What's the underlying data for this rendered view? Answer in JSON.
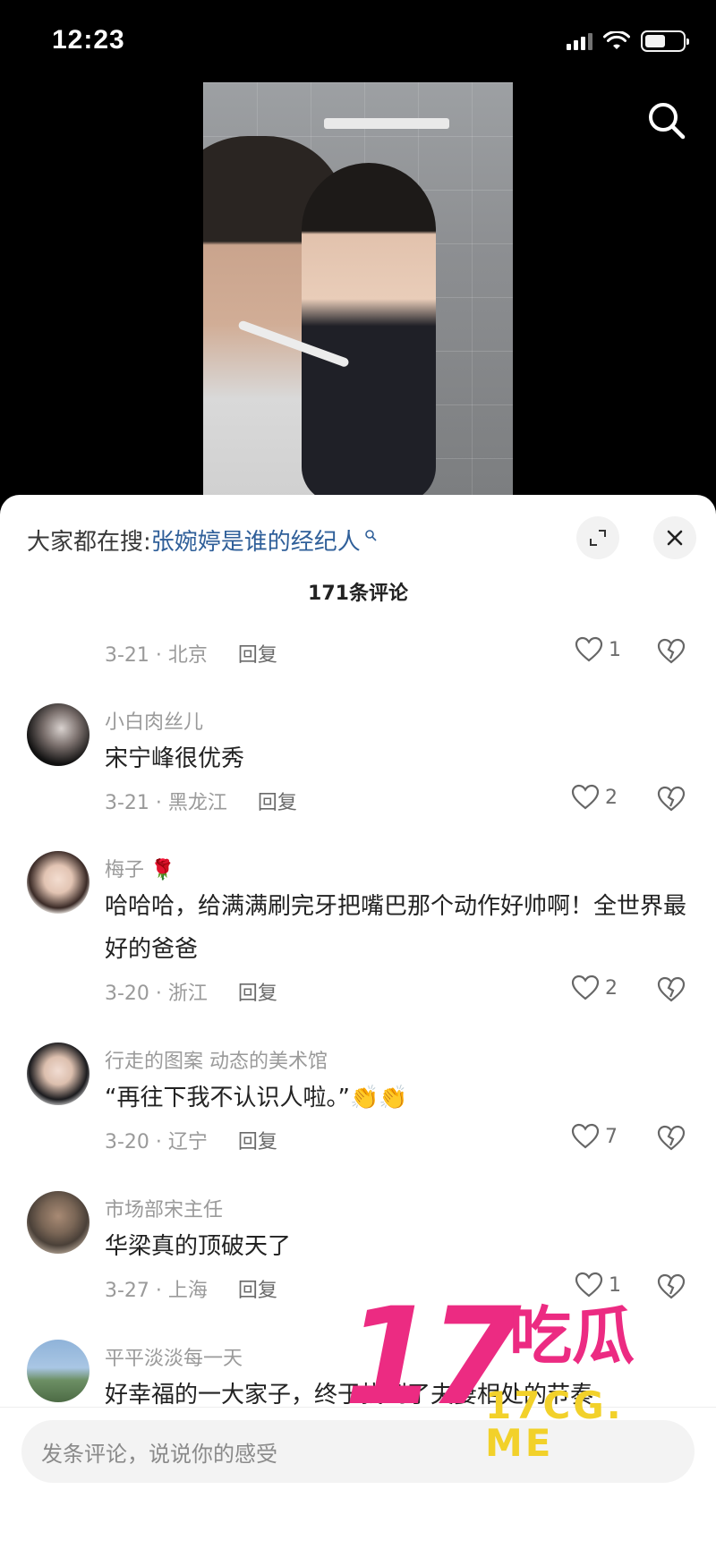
{
  "status_bar": {
    "time": "12:23"
  },
  "sheet": {
    "trending_prefix": "大家都在搜:",
    "trending_link": "张婉婷是谁的经纪人",
    "comment_count": "171条评论"
  },
  "comments": [
    {
      "date_location": "3-21 · 北京",
      "reply": "回复",
      "likes": "1"
    },
    {
      "username": "小白肉丝儿",
      "text": "宋宁峰很优秀",
      "date_location": "3-21 · 黑龙江",
      "reply": "回复",
      "likes": "2"
    },
    {
      "username": "梅子",
      "badge": "🌹",
      "text": "哈哈哈，给满满刷完牙把嘴巴那个动作好帅啊！全世界最好的爸爸",
      "date_location": "3-20 · 浙江",
      "reply": "回复",
      "likes": "2"
    },
    {
      "username": "行走的图案 动态的美术馆",
      "text": "“再往下我不认识人啦。”👏👏",
      "date_location": "3-20 · 辽宁",
      "reply": "回复",
      "likes": "7"
    },
    {
      "username": "市场部宋主任",
      "text": "华梁真的顶破天了",
      "date_location": "3-27 · 上海",
      "reply": "回复",
      "likes": "1"
    },
    {
      "username": "平平淡淡每一天",
      "text": "好幸福的一大家子，终于找到了夫妻相处的节奏"
    }
  ],
  "input": {
    "placeholder": "发条评论，说说你的感受"
  },
  "watermark": {
    "big": "17",
    "cn": "吃瓜",
    "url": "17CG. ME"
  },
  "colors": {
    "link": "#2f5f99",
    "watermark_pink": "#ec2b82",
    "watermark_yellow": "#f2d12a"
  }
}
